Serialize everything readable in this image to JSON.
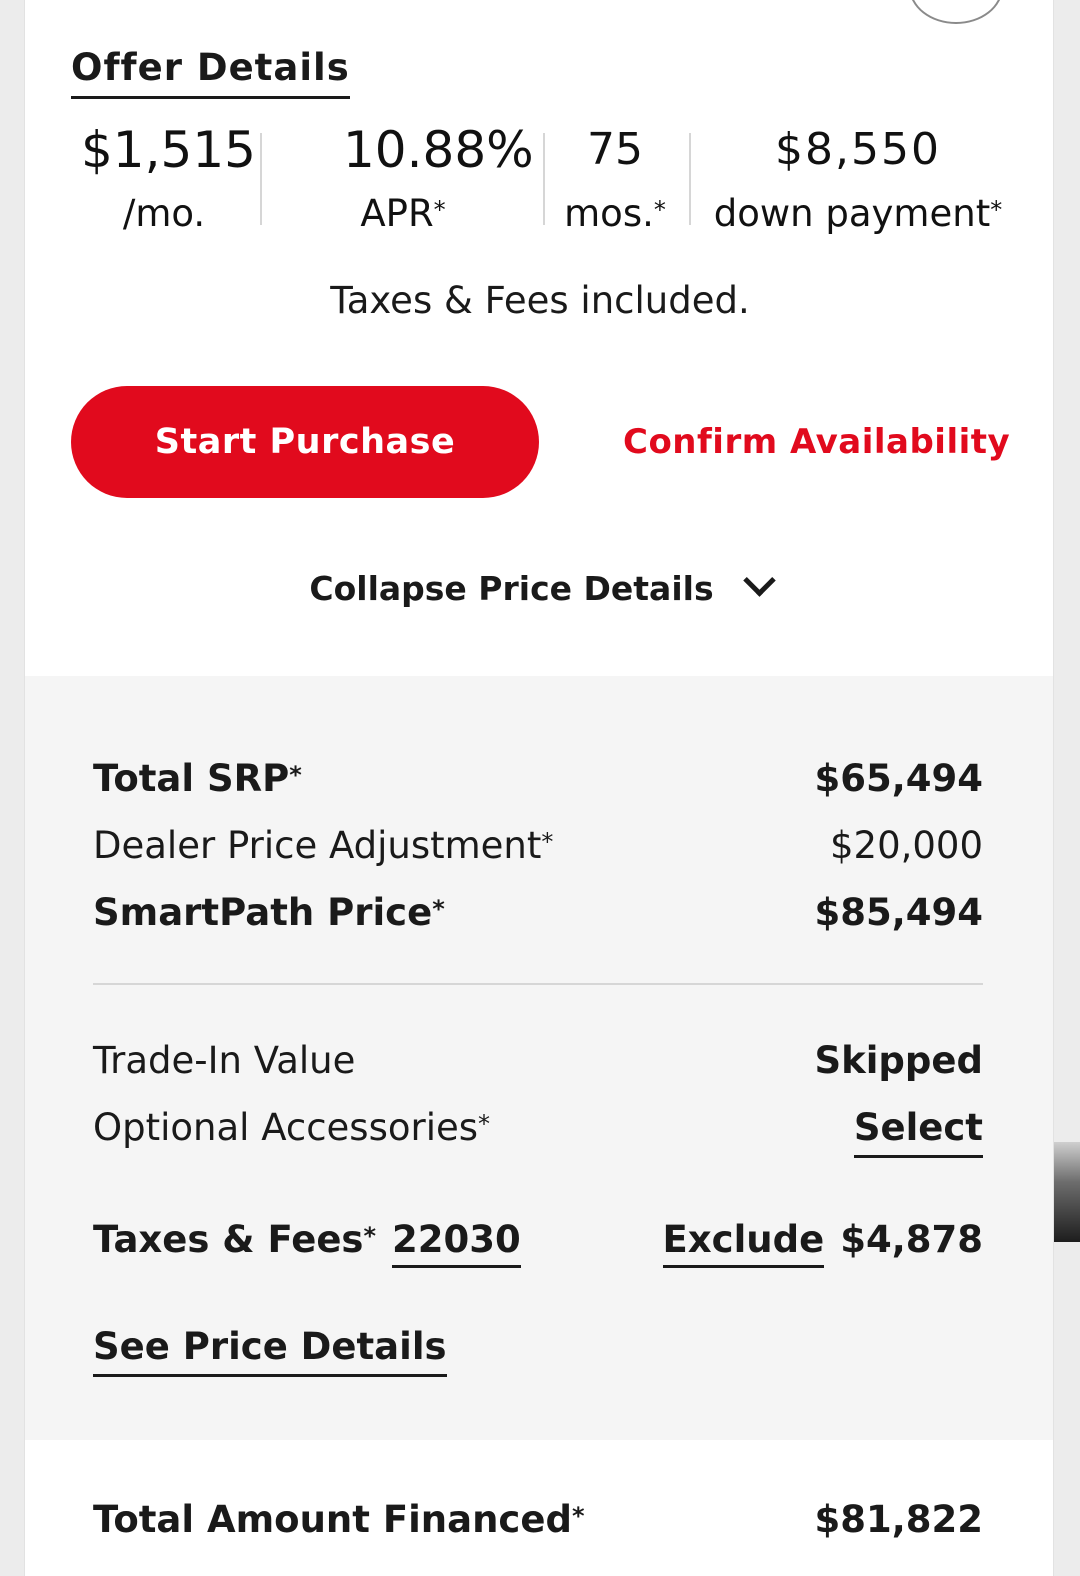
{
  "offer": {
    "title": "Offer Details",
    "monthly_payment": "$1,515",
    "monthly_unit": "/mo.",
    "apr_value": "10.88%",
    "apr_label": "APR",
    "term_value": "75",
    "term_label": "mos.",
    "down_payment_value": "$8,550",
    "down_payment_label": "down payment",
    "asterisk": "*",
    "taxes_note": "Taxes & Fees included."
  },
  "actions": {
    "start_purchase": "Start Purchase",
    "confirm_availability": "Confirm Availability",
    "collapse_details": "Collapse Price Details"
  },
  "price_details": {
    "total_srp_label": "Total SRP",
    "total_srp_value": "$65,494",
    "dealer_adjustment_label": "Dealer Price Adjustment",
    "dealer_adjustment_value": "$20,000",
    "smartpath_label": "SmartPath Price",
    "smartpath_value": "$85,494",
    "trade_in_label": "Trade-In Value",
    "trade_in_value": "Skipped",
    "accessories_label": "Optional Accessories",
    "accessories_action": "Select",
    "taxes_label": "Taxes & Fees",
    "zip_code": "22030",
    "exclude_label": "Exclude",
    "taxes_value": "$4,878",
    "see_price_details": "See Price Details"
  },
  "total": {
    "label": "Total Amount Financed",
    "value": "$81,822"
  },
  "icons": [
    "circle-icon",
    "chevron-down-icon"
  ],
  "colors": {
    "accent": "#e10a1d",
    "panel_bg": "#f5f5f5",
    "text": "#1a1a1a"
  }
}
